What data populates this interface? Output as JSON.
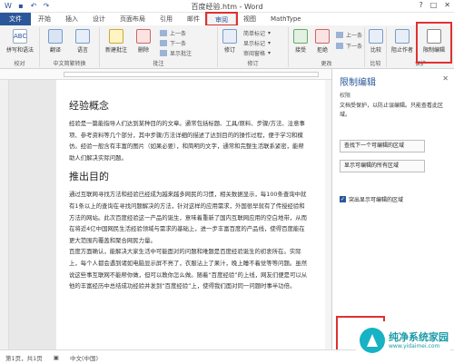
{
  "window": {
    "title": "百度经验.htm - Word",
    "min": "?",
    "restore": "□",
    "close": "✕"
  },
  "tabs": [
    "文件",
    "开始",
    "插入",
    "设计",
    "页面布局",
    "引用",
    "邮件",
    "审阅",
    "视图",
    "MathType"
  ],
  "ribbon": {
    "groups": [
      {
        "label": "校对",
        "buttons": [
          "拼写和语法"
        ]
      },
      {
        "label": "中文简繁转换",
        "buttons": [
          "翻译",
          "语言"
        ]
      },
      {
        "label": "批注",
        "buttons": [
          "新建批注",
          "删除",
          "上一条",
          "下一条",
          "显示批注"
        ]
      },
      {
        "label": "修订",
        "buttons": [
          "修订",
          "简单标记",
          "显示标记",
          "审阅窗格"
        ]
      },
      {
        "label": "更改",
        "buttons": [
          "接受",
          "拒绝",
          "上一条",
          "下一条"
        ]
      },
      {
        "label": "比较",
        "buttons": [
          "比较"
        ]
      },
      {
        "label": "保护",
        "buttons": [
          "阻止作者",
          "限制编辑"
        ]
      }
    ]
  },
  "document": {
    "heading1": "经验概念",
    "para1": "经验是一篇能指导人们达到某种目的的文章。通常包括标题、工具/原料、步骤/方法、注意事项、参考资料等几个部分，其中步骤/方法详细的描述了达到目的的操作过程，便于学习和模仿。经验一般含有丰富的图片（如果必要），和简明的文字，通常和完整生活联系紧密，能帮助人们解决实际问题。",
    "heading2": "推出目的",
    "para2": "通过互联网寻找方法和经验已经成为越来越多网民的习惯，相关数据显示，每100条查询中就有1条以上的查询在寻找问题解决的方法，针对这样的应用需求，外国很早就有了传授经验和方法的网站。此次百度经验这一产品的诞生，意味着重新了国内互联网应用的空白地带，从而在将近4亿中国网民生活经验领域与需求的基础上，进一步丰富百度的产品线，使得百度能在更大范围内覆盖和聚合网民力量。",
    "para3": "百度方面确认，能解决大家生活中可能面对的问题和难题是百度经验诞生的初衷所在。实际上，每个人都会遇到诸如电脑显示屏不亮了，衣服沾上了果汁，晚上睡不着觉等等问题。虽然说这些事互联网不能帮你做，但可以教你怎么做。随着“百度经验”的上线，网友们便是可以从他的丰富经历中总结成功经验并发到“百度经验”上，使得我们面对同一问题时事半功倍。"
  },
  "panel": {
    "title": "限制编辑",
    "close": "✕",
    "subtitle": "权限",
    "desc": "文档受保护，以防止误编辑。只能查看此区域。",
    "btn_next": "查找下一个可编辑的区域",
    "btn_all": "显示可编辑的所有区域",
    "check_label": "突出显示可编辑的区域"
  },
  "status": {
    "page": "第1页，共1页",
    "lang": "中文(中国)"
  },
  "watermark": {
    "brand": "纯净系统家园",
    "url": "www.yidaimei.com"
  }
}
